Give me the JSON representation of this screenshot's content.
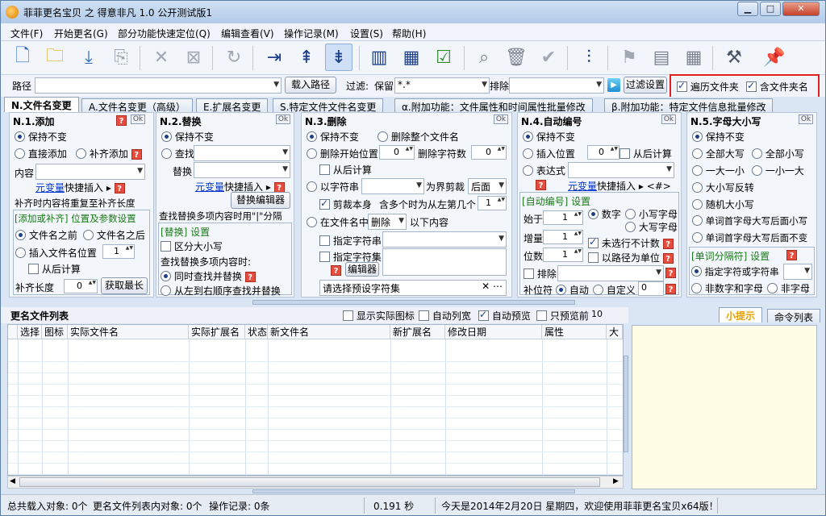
{
  "window": {
    "title": "菲菲更名宝贝 之 得意非凡 1.0 公开测试版1"
  },
  "menu": [
    "文件(F)",
    "开始更名(G)",
    "部分功能快速定位(Q)",
    "编辑查看(V)",
    "操作记录(M)",
    "设置(S)",
    "帮助(H)"
  ],
  "pathbar": {
    "path_label": "路径",
    "path_value": "",
    "load_button": "载入路径",
    "filter_label": "过滤:",
    "keep_label": "保留",
    "keep_value": "*.*",
    "exclude_label": "排除",
    "exclude_value": "",
    "filter_settings_button": "过滤设置",
    "traverse_folders": "遍历文件夹",
    "include_folder_names": "含文件夹名"
  },
  "tabs": [
    "N.文件名变更",
    "A.文件名变更（高级）",
    "E.扩展名变更",
    "S.特定文件文件名变更",
    "α.附加功能：文件属性和时间属性批量修改",
    "β.附加功能：特定文件信息批量修改"
  ],
  "panel1": {
    "title": "N.1.添加",
    "ok": "Ok",
    "keep": "保持不变",
    "direct_add": "直接添加",
    "pad_add": "补齐添加",
    "content_label": "内容",
    "meta_var": "元变量",
    "quick_insert": "快捷插入",
    "pad_note": "补齐时内容将重复至补齐长度",
    "group_title": "[添加或补齐] 位置及参数设置",
    "before_name": "文件名之前",
    "after_name": "文件名之后",
    "insert_pos": "插入文件名位置",
    "insert_pos_value": "1",
    "from_end": "从后计算",
    "pad_len_label": "补齐长度",
    "pad_len_value": "0",
    "get_max_button": "获取最长"
  },
  "panel2": {
    "title": "N.2.替换",
    "ok": "Ok",
    "keep": "保持不变",
    "find": "查找",
    "replace": "替换",
    "meta_var": "元变量",
    "quick_insert": "快捷插入",
    "editor_button": "替换编辑器",
    "multi_note": "查找替换多项内容时用\"|\"分隔",
    "group_title": "[替换] 设置",
    "case_sensitive": "区分大小写",
    "multi_when": "查找替换多项内容时:",
    "simultaneous": "同时查找并替换",
    "left_to_right": "从左到右顺序查找并替换"
  },
  "panel3": {
    "title": "N.3.删除",
    "ok": "Ok",
    "keep": "保持不变",
    "delete_all": "删除整个文件名",
    "delete_start": "删除开始位置",
    "start_value": "0",
    "delete_count": "删除字符数",
    "count_value": "0",
    "from_end": "从后计算",
    "by_string": "以字符串",
    "as_boundary": "为界剪裁",
    "after_option": "后面",
    "cut_self": "剪裁本身",
    "multiple_note": "含多个时为从左第几个",
    "nth_value": "1",
    "in_name": "在文件名中",
    "delete_option": "删除",
    "following": "以下内容",
    "specify_string": "指定字符串",
    "specify_set": "指定字符集",
    "editor_button": "编辑器",
    "preset_placeholder": "请选择预设字符集"
  },
  "panel4": {
    "title": "N.4.自动编号",
    "ok": "Ok",
    "keep": "保持不变",
    "insert_pos": "插入位置",
    "pos_value": "0",
    "from_end": "从后计算",
    "expression": "表达式",
    "meta_var": "元变量",
    "quick_insert": "快捷插入",
    "hash_tag": "<#>",
    "group_title": "[自动编号] 设置",
    "start_label": "始于",
    "start_value": "1",
    "step_label": "增量",
    "step_value": "1",
    "digits_label": "位数",
    "digits_value": "1",
    "digit_opt": "数字",
    "lower_opt": "小写字母",
    "upper_opt": "大写字母",
    "unselected_skip": "未选行不计数",
    "by_path": "以路径为单位",
    "exclude": "排除",
    "pad_char_label": "补位符",
    "auto_opt": "自动",
    "custom_opt": "自定义",
    "custom_value": "0"
  },
  "panel5": {
    "title": "N.5.字母大小写",
    "ok": "Ok",
    "keep": "保持不变",
    "all_upper": "全部大写",
    "all_lower": "全部小写",
    "upper_lower": "一大一小",
    "lower_upper": "一小一大",
    "invert": "大小写反转",
    "random": "随机大小写",
    "word_first_upper": "单词首字母大写后面小写",
    "word_first_upper_keep": "单词首字母大写后面不变",
    "group_title": "[单词分隔符] 设置",
    "specified": "指定字符或字符串",
    "non_alnum": "非数字和字母",
    "non_char": "非字母"
  },
  "list": {
    "title": "更名文件列表",
    "show_icon": "显示实际图标",
    "auto_width": "自动列宽",
    "auto_preview": "自动预览",
    "preview_first": "只预览前",
    "preview_count": "10",
    "columns": [
      "选择",
      "图标",
      "实际文件名",
      "实际扩展名",
      "状态",
      "新文件名",
      "新扩展名",
      "修改日期",
      "属性",
      "大小"
    ]
  },
  "rightpane": {
    "tips_tab": "小提示",
    "cmd_tab": "命令列表"
  },
  "status": {
    "total": "总共载入对象: 0个",
    "in_list": "更名文件列表内对象: 0个",
    "ops": "操作记录: 0条",
    "time": "0.191 秒",
    "welcome": "今天是2014年2月20日 星期四，欢迎使用菲菲更名宝贝x64版！"
  },
  "colors": {
    "accent": "#1a7a1a",
    "highlight_box": "#e02020",
    "tips_tab": "#e8a000"
  }
}
